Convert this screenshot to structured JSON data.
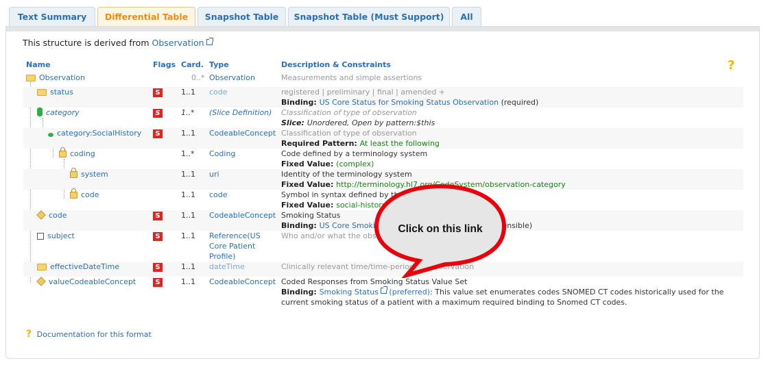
{
  "tabs": [
    {
      "label": "Text Summary",
      "active": false
    },
    {
      "label": "Differential Table",
      "active": true
    },
    {
      "label": "Snapshot Table",
      "active": false
    },
    {
      "label": "Snapshot Table (Must Support)",
      "active": false
    },
    {
      "label": "All",
      "active": false
    }
  ],
  "derived": {
    "prefix": "This structure is derived from ",
    "link": "Observation"
  },
  "headers": {
    "name": "Name",
    "flags": "Flags",
    "card": "Card.",
    "type": "Type",
    "desc": "Description & Constraints"
  },
  "rows": [
    {
      "name": "Observation",
      "flag": "",
      "card": "0..*",
      "type": "Observation",
      "desc1": "Measurements and simple assertions"
    },
    {
      "name": "status",
      "flag": "S",
      "card": "1..1",
      "type": "code",
      "desc1": "registered | preliminary | final | amended +",
      "desc2_label": "Binding: ",
      "desc2_link": "US Core Status for Smoking Status Observation",
      "desc2_tail": " (required)"
    },
    {
      "name": "category",
      "flag": "S",
      "card": "1..*",
      "type": "(Slice Definition)",
      "desc1": "Classification of type of observation",
      "desc2_label": "Slice: ",
      "desc2_text": "Unordered, Open by pattern:$this"
    },
    {
      "name": "category:SocialHistory",
      "flag": "S",
      "card": "1..1",
      "type": "CodeableConcept",
      "desc1": "Classification of type of observation",
      "desc2_label": "Required Pattern: ",
      "desc2_text": "At least the following"
    },
    {
      "name": "coding",
      "flag": "",
      "card": "1..*",
      "type": "Coding",
      "desc1": "Code defined by a terminology system",
      "desc2_label": "Fixed Value: ",
      "desc2_text": "(complex)"
    },
    {
      "name": "system",
      "flag": "",
      "card": "1..1",
      "type": "uri",
      "desc1": "Identity of the terminology system",
      "desc2_label": "Fixed Value: ",
      "desc2_text": "http://terminology.hl7.org/CodeSystem/observation-category"
    },
    {
      "name": "code",
      "flag": "",
      "card": "1..1",
      "type": "code",
      "desc1": "Symbol in syntax defined by the system",
      "desc2_label": "Fixed Value: ",
      "desc2_text": "social-history"
    },
    {
      "name": "code",
      "flag": "S",
      "card": "1..1",
      "type": "CodeableConcept",
      "desc1": "Smoking Status",
      "desc2_label": "Binding: ",
      "desc2_link": "US Core Smoking Status Observation Codes",
      "desc2_tail": " (extensible)"
    },
    {
      "name": "subject",
      "flag": "S",
      "card": "1..1",
      "type_lines": [
        "Reference(US",
        "Core Patient",
        "Profile)"
      ],
      "desc1": "Who and/or what the observation is about"
    },
    {
      "name": "effectiveDateTime",
      "flag": "S",
      "card": "1..1",
      "type": "dateTime",
      "desc1": "Clinically relevant time/time-period for observation"
    },
    {
      "name": "valueCodeableConcept",
      "flag": "S",
      "card": "1..1",
      "type": "CodeableConcept",
      "desc1": "Coded Responses from Smoking Status Value Set",
      "desc2_label": "Binding: ",
      "desc2_link": "Smoking Status",
      "desc2_mid": " (preferred)",
      "desc2_tail": ": This value set enumerates codes SNOMED CT codes historically used for the",
      "desc3": "current smoking status of a patient with a maximum required binding to Snomed CT codes."
    }
  ],
  "doc_link": "Documentation for this format",
  "callout": "Click on this link",
  "colors": {
    "tab_active": "#f08c14",
    "link": "#2a6fb5",
    "flag": "#e32322",
    "callout_border": "#e8000b",
    "pattern": "#118811"
  }
}
